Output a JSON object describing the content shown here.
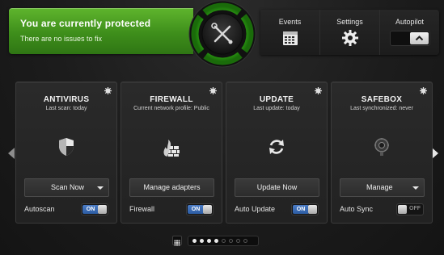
{
  "status": {
    "title": "You are currently protected",
    "subtitle": "There are no issues to fix",
    "color": "#4fa324"
  },
  "center_button": {
    "icon": "tools-icon",
    "ring_color": "#3dd11a"
  },
  "topnav": {
    "events_label": "Events",
    "settings_label": "Settings",
    "autopilot_label": "Autopilot"
  },
  "cards": [
    {
      "title": "ANTIVIRUS",
      "subtitle": "Last scan: today",
      "icon": "shield-icon",
      "action_label": "Scan Now",
      "action_dropdown": true,
      "toggle_label": "Autoscan",
      "toggle_state": "ON"
    },
    {
      "title": "FIREWALL",
      "subtitle": "Current network profile: Public",
      "icon": "firewall-icon",
      "action_label": "Manage adapters",
      "action_dropdown": false,
      "toggle_label": "Firewall",
      "toggle_state": "ON"
    },
    {
      "title": "UPDATE",
      "subtitle": "Last update: today",
      "icon": "refresh-icon",
      "action_label": "Update Now",
      "action_dropdown": false,
      "toggle_label": "Auto Update",
      "toggle_state": "ON"
    },
    {
      "title": "SAFEBOX",
      "subtitle": "Last synchronized: never",
      "icon": "safe-icon",
      "action_label": "Manage",
      "action_dropdown": true,
      "toggle_label": "Auto Sync",
      "toggle_state": "OFF"
    }
  ],
  "pager": {
    "total_pages": 8,
    "active_pages": 4
  },
  "accent_blue": "#3a6cb8"
}
